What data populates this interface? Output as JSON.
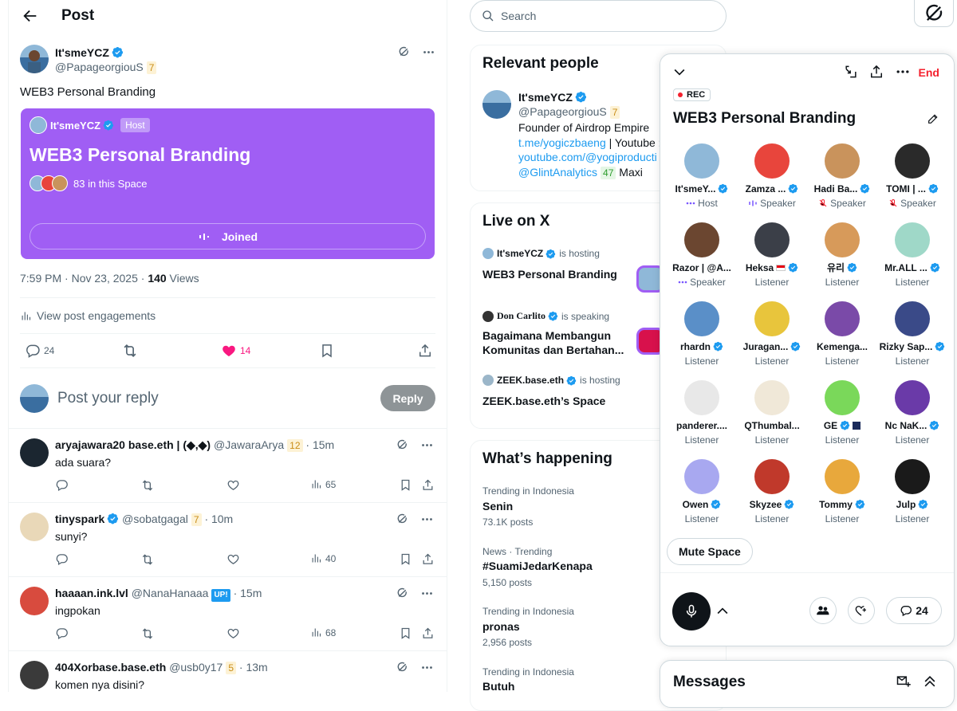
{
  "header": {
    "title": "Post"
  },
  "post": {
    "author_name": "It'smeYCZ",
    "author_handle": "@PapageorgiouS",
    "author_badge": "7",
    "text": "WEB3 Personal Branding",
    "space_card": {
      "host_name": "It'smeYCZ",
      "host_badge": "Host",
      "title": "WEB3 Personal Branding",
      "listeners": "83 in this Space",
      "joined_label": "Joined",
      "bg_color": "#a05ef4"
    },
    "time": "7:59 PM · Nov 23, 2025 · ",
    "views_count": "140",
    "views_label": " Views",
    "engagements_label": "View post engagements",
    "replies": "24",
    "likes": "14",
    "reply_placeholder": "Post your reply",
    "reply_button": "Reply"
  },
  "comments": [
    {
      "name": "aryajawara20 base.eth | (◆,◆)",
      "handle": "@JawaraArya",
      "badge": "12",
      "time": "· 15m",
      "text": "ada suara?",
      "views": "65"
    },
    {
      "name": "tinyspark",
      "handle": "@sobatgagal",
      "badge": "7",
      "time": "· 10m",
      "text": "sunyi?",
      "views": "40"
    },
    {
      "name": "haaaan.ink.lvl",
      "handle": "@NanaHanaaa",
      "badge": "UP!",
      "time": "· 15m",
      "text": "ingpokan",
      "views": "68"
    },
    {
      "name": "404Xorbase.base.eth",
      "handle": "@usb0y17",
      "badge": "5",
      "time": "· 13m",
      "text": "komen nya disini?",
      "views": ""
    }
  ],
  "search": {
    "placeholder": "Search"
  },
  "relevant": {
    "title": "Relevant people",
    "name": "It'smeYCZ",
    "handle": "@PapageorgiouS",
    "badge": "7",
    "bio1": "Founder of Airdrop Empire",
    "bio2_link": "t.me/yogiczbaeng",
    "bio2_text": " | Youtube :",
    "bio3_link": "youtube.com/@yogiproducti",
    "bio4_link": "@GlintAnalytics",
    "bio4_badge": "47",
    "bio4_text": " Maxi"
  },
  "live": {
    "title": "Live on X",
    "items": [
      {
        "host": "It'smeYCZ",
        "status": "is hosting",
        "title": "WEB3 Personal Branding"
      },
      {
        "host": "Don Carlito",
        "status": "is speaking",
        "title": "Bagaimana  Membangun Komunitas dan Bertahan..."
      },
      {
        "host": "ZEEK.base.eth",
        "status": "is hosting",
        "title": "ZEEK.base.eth’s Space"
      }
    ]
  },
  "trending": {
    "title": "What’s happening",
    "items": [
      {
        "context": "Trending in Indonesia",
        "topic": "Senin",
        "count": "73.1K posts"
      },
      {
        "context": "News · Trending",
        "topic": "#SuamiJedarKenapa",
        "count": "5,150 posts"
      },
      {
        "context": "Trending in Indonesia",
        "topic": "pronas",
        "count": "2,956 posts"
      },
      {
        "context": "Trending in Indonesia",
        "topic": "Butuh",
        "count": ""
      }
    ]
  },
  "space": {
    "end_label": "End",
    "rec_label": "REC",
    "title": "WEB3 Personal Branding",
    "participants": [
      {
        "name": "It'smeY...",
        "role": "Host",
        "icon": "dots"
      },
      {
        "name": "Zamza ...",
        "role": "Speaker",
        "icon": "wave"
      },
      {
        "name": "Hadi Ba...",
        "role": "Speaker",
        "icon": "mute"
      },
      {
        "name": "TOMI | ...",
        "role": "Speaker",
        "icon": "mute"
      },
      {
        "name": "Razor | @A...",
        "role": "Speaker",
        "icon": "dots"
      },
      {
        "name": "Heksa",
        "role": "Listener",
        "icon": ""
      },
      {
        "name": "유리",
        "role": "Listener",
        "icon": ""
      },
      {
        "name": "Mr.ALL ...",
        "role": "Listener",
        "icon": ""
      },
      {
        "name": "rhardn",
        "role": "Listener",
        "icon": ""
      },
      {
        "name": "Juragan...",
        "role": "Listener",
        "icon": ""
      },
      {
        "name": "Kemenga...",
        "role": "Listener",
        "icon": ""
      },
      {
        "name": "Rizky Sap...",
        "role": "Listener",
        "icon": ""
      },
      {
        "name": "panderer....",
        "role": "Listener",
        "icon": ""
      },
      {
        "name": "QThumbal...",
        "role": "Listener",
        "icon": ""
      },
      {
        "name": "GE",
        "role": "Listener",
        "icon": ""
      },
      {
        "name": "Nc NaK...",
        "role": "Listener",
        "icon": ""
      },
      {
        "name": "Owen",
        "role": "Listener",
        "icon": ""
      },
      {
        "name": "Skyzee",
        "role": "Listener",
        "icon": ""
      },
      {
        "name": "Tommy",
        "role": "Listener",
        "icon": ""
      },
      {
        "name": "Julp",
        "role": "Listener",
        "icon": ""
      }
    ],
    "mute_label": "Mute Space",
    "comment_count": "24"
  },
  "messages": {
    "title": "Messages"
  },
  "colors": {
    "verified": "#1d9bf0",
    "like": "#f91880",
    "end": "#f4212e",
    "space_purple": "#a05ef4"
  }
}
